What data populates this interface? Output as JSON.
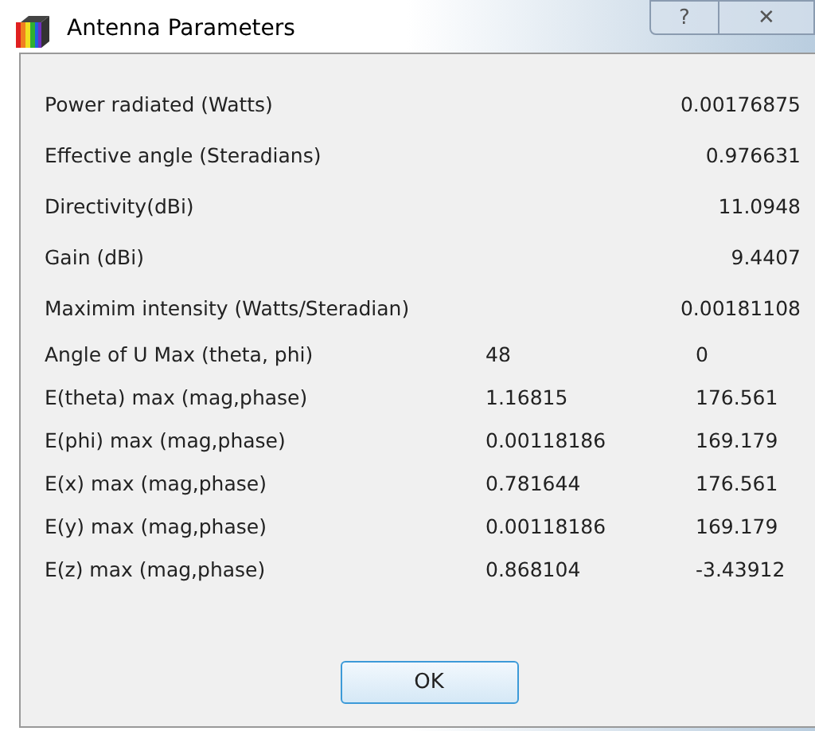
{
  "window": {
    "title": "Antenna Parameters",
    "buttons": [
      "?",
      "✕"
    ]
  },
  "results": [
    {
      "label": "Power radiated (Watts)",
      "value": "0.00176875"
    },
    {
      "label": "Effective angle (Steradians)",
      "value": "0.976631"
    },
    {
      "label": "Directivity(dBi)",
      "value": "11.0948"
    },
    {
      "label": "Gain (dBi)",
      "value": "9.4407"
    },
    {
      "label": "Maximim intensity (Watts/Steradian)",
      "value": "0.00181108"
    }
  ],
  "pairs": [
    {
      "label": "Angle of U Max (theta, phi)",
      "value_1": "48",
      "value_2": "0"
    },
    {
      "label": "E(theta) max (mag,phase)",
      "value_1": "1.16815",
      "value_2": "176.561"
    },
    {
      "label": "E(phi) max (mag,phase)",
      "value_1": "0.00118186",
      "value_2": "169.179"
    },
    {
      "label": "E(x) max (mag,phase)",
      "value_1": "0.781644",
      "value_2": "176.561"
    },
    {
      "label": "E(y) max (mag,phase)",
      "value_1": "0.00118186",
      "value_2": "169.179"
    },
    {
      "label": "E(z) max (mag,phase)",
      "value_1": "0.868104",
      "value_2": "-3.43912"
    }
  ],
  "ok_button": "OK"
}
